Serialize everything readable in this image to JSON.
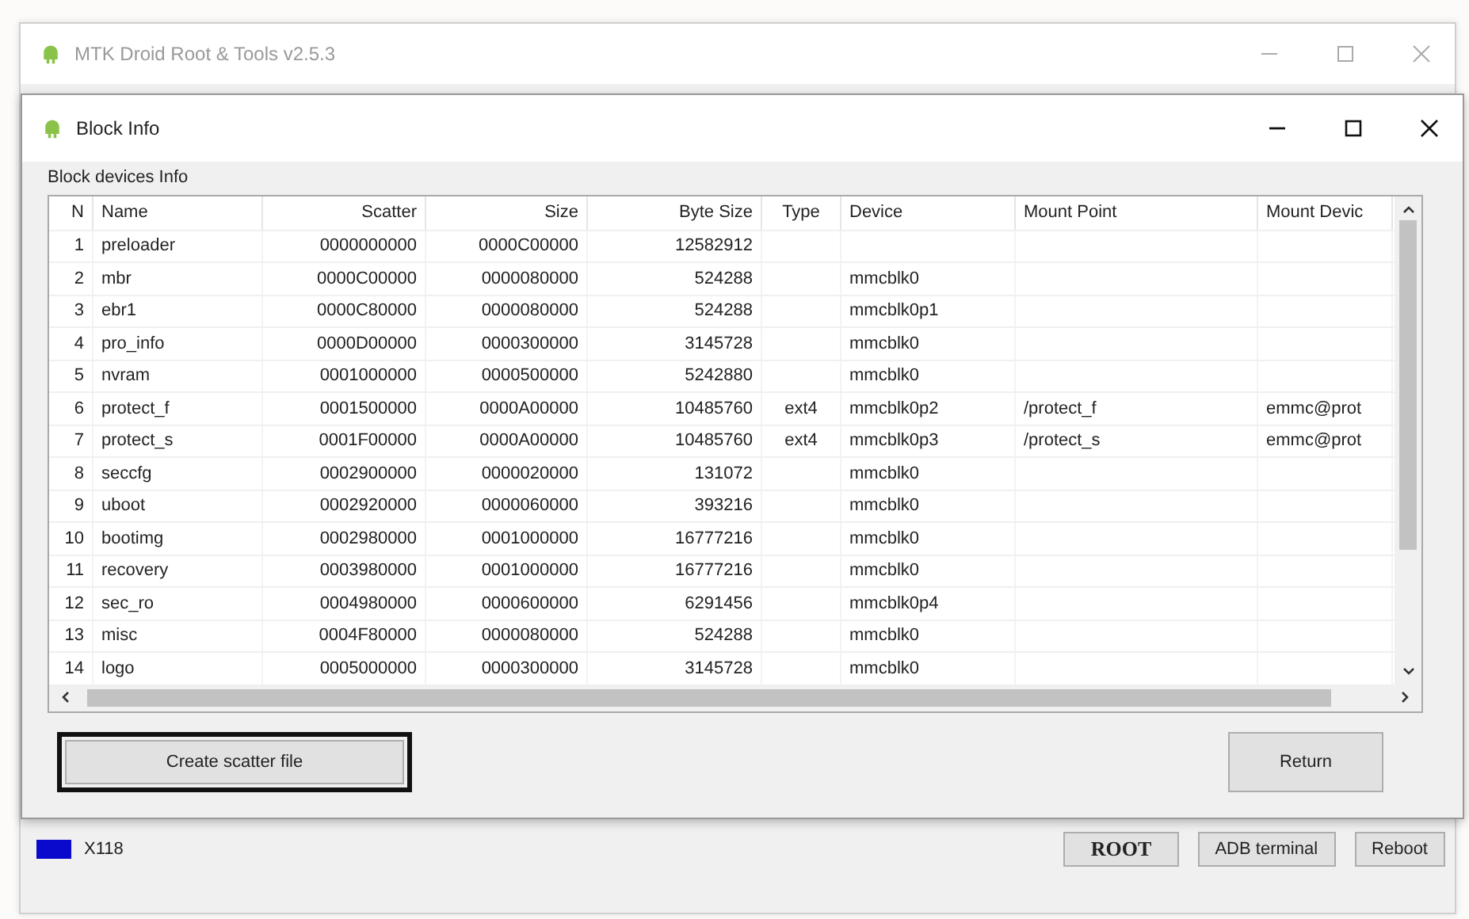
{
  "main_window": {
    "title": "MTK Droid Root & Tools v2.5.3"
  },
  "dialog": {
    "title": "Block Info",
    "group_label": "Block devices Info",
    "table": {
      "columns": [
        "N",
        "Name",
        "Scatter",
        "Size",
        "Byte Size",
        "Type",
        "Device",
        "Mount Point",
        "Mount Devic"
      ],
      "rows": [
        {
          "n": "1",
          "name": "preloader",
          "scatter": "0000000000",
          "size": "0000C00000",
          "byte_size": "12582912"
        },
        {
          "n": "2",
          "name": "mbr",
          "scatter": "0000C00000",
          "size": "0000080000",
          "byte_size": "524288",
          "device": "mmcblk0"
        },
        {
          "n": "3",
          "name": "ebr1",
          "scatter": "0000C80000",
          "size": "0000080000",
          "byte_size": "524288",
          "device": "mmcblk0p1"
        },
        {
          "n": "4",
          "name": "pro_info",
          "scatter": "0000D00000",
          "size": "0000300000",
          "byte_size": "3145728",
          "device": "mmcblk0"
        },
        {
          "n": "5",
          "name": "nvram",
          "scatter": "0001000000",
          "size": "0000500000",
          "byte_size": "5242880",
          "device": "mmcblk0"
        },
        {
          "n": "6",
          "name": "protect_f",
          "scatter": "0001500000",
          "size": "0000A00000",
          "byte_size": "10485760",
          "type": "ext4",
          "device": "mmcblk0p2",
          "mount_point": "/protect_f",
          "mount_device": "emmc@prot"
        },
        {
          "n": "7",
          "name": "protect_s",
          "scatter": "0001F00000",
          "size": "0000A00000",
          "byte_size": "10485760",
          "type": "ext4",
          "device": "mmcblk0p3",
          "mount_point": "/protect_s",
          "mount_device": "emmc@prot"
        },
        {
          "n": "8",
          "name": "seccfg",
          "scatter": "0002900000",
          "size": "0000020000",
          "byte_size": "131072",
          "device": "mmcblk0"
        },
        {
          "n": "9",
          "name": "uboot",
          "scatter": "0002920000",
          "size": "0000060000",
          "byte_size": "393216",
          "device": "mmcblk0"
        },
        {
          "n": "10",
          "name": "bootimg",
          "scatter": "0002980000",
          "size": "0001000000",
          "byte_size": "16777216",
          "device": "mmcblk0"
        },
        {
          "n": "11",
          "name": "recovery",
          "scatter": "0003980000",
          "size": "0001000000",
          "byte_size": "16777216",
          "device": "mmcblk0"
        },
        {
          "n": "12",
          "name": "sec_ro",
          "scatter": "0004980000",
          "size": "0000600000",
          "byte_size": "6291456",
          "device": "mmcblk0p4"
        },
        {
          "n": "13",
          "name": "misc",
          "scatter": "0004F80000",
          "size": "0000080000",
          "byte_size": "524288",
          "device": "mmcblk0"
        },
        {
          "n": "14",
          "name": "logo",
          "scatter": "0005000000",
          "size": "0000300000",
          "byte_size": "3145728",
          "device": "mmcblk0"
        }
      ]
    },
    "buttons": [
      {
        "label": "Create scatter file",
        "focused": true
      },
      {
        "label": "Return",
        "focused": false
      }
    ]
  },
  "status_bar": {
    "indicator": {
      "color": "#0a0acc",
      "label": "X118"
    },
    "buttons": [
      {
        "label": "ROOT",
        "kind": "emphasis"
      },
      {
        "label": "ADB terminal",
        "kind": "plain"
      },
      {
        "label": "Reboot",
        "kind": "plain"
      }
    ]
  }
}
